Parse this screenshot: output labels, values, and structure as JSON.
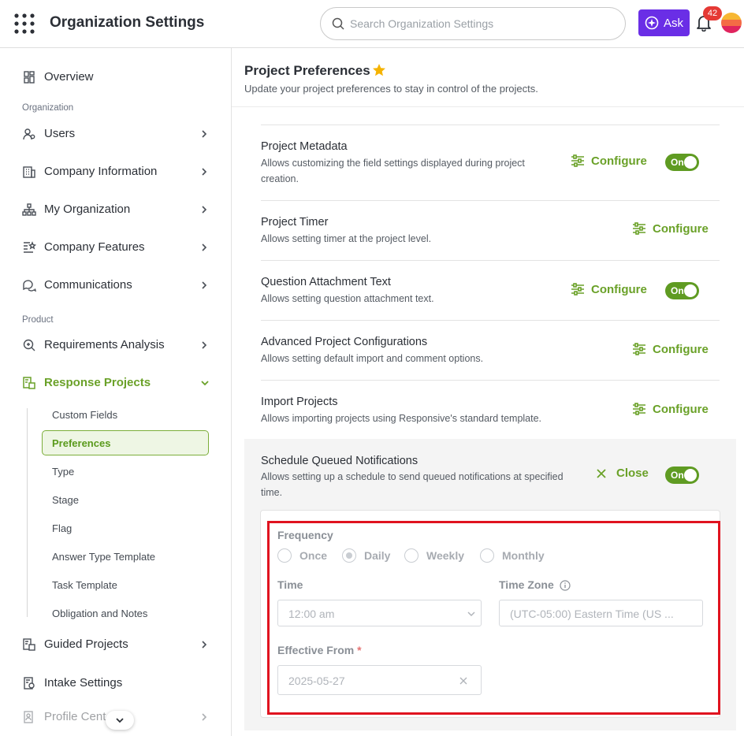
{
  "header": {
    "title": "Organization Settings",
    "search_placeholder": "Search Organization Settings",
    "ask_label": "Ask",
    "notification_count": "42"
  },
  "sidebar": {
    "items_top": [
      {
        "label": "Overview",
        "icon": "overview-icon"
      }
    ],
    "section_org": "Organization",
    "org_items": [
      {
        "label": "Users",
        "icon": "users-icon"
      },
      {
        "label": "Company Information",
        "icon": "building-icon"
      },
      {
        "label": "My Organization",
        "icon": "org-chart-icon"
      },
      {
        "label": "Company Features",
        "icon": "features-icon"
      },
      {
        "label": "Communications",
        "icon": "chat-icon"
      }
    ],
    "section_product": "Product",
    "product_items": [
      {
        "label": "Requirements Analysis",
        "icon": "analysis-icon"
      },
      {
        "label": "Response Projects",
        "icon": "response-projects-icon",
        "active": true
      },
      {
        "label": "Guided Projects",
        "icon": "guided-projects-icon"
      },
      {
        "label": "Intake Settings",
        "icon": "intake-icon"
      },
      {
        "label": "Profile Cent",
        "icon": "profile-icon"
      }
    ],
    "sub_items": [
      "Custom Fields",
      "Preferences",
      "Type",
      "Stage",
      "Flag",
      "Answer Type Template",
      "Task Template",
      "Obligation and Notes"
    ],
    "selected_sub": "Preferences"
  },
  "page": {
    "title": "Project Preferences",
    "subtitle": "Update your project preferences to stay in control of the projects."
  },
  "configure_label": "Configure",
  "close_label": "Close",
  "toggle_on_label": "On",
  "rows": [
    {
      "title": "Project Metadata",
      "desc": "Allows customizing the field settings displayed during project creation.",
      "toggle": true
    },
    {
      "title": "Project Timer",
      "desc": "Allows setting timer at the project level.",
      "toggle": false
    },
    {
      "title": "Question Attachment Text",
      "desc": "Allows setting question attachment text.",
      "toggle": true
    },
    {
      "title": "Advanced Project Configurations",
      "desc": "Allows setting default import and comment options.",
      "toggle": false
    },
    {
      "title": "Import Projects",
      "desc": "Allows importing projects using Responsive's standard template.",
      "toggle": false
    }
  ],
  "schedule": {
    "title": "Schedule Queued Notifications",
    "desc": "Allows setting up a schedule to send queued notifications at specified time.",
    "frequency_label": "Frequency",
    "frequency_options": [
      "Once",
      "Daily",
      "Weekly",
      "Monthly"
    ],
    "frequency_selected": "Daily",
    "time_label": "Time",
    "time_value": "12:00 am",
    "timezone_label": "Time Zone",
    "timezone_value": "(UTC-05:00) Eastern Time (US ...",
    "effective_label": "Effective From",
    "effective_value": "2025-05-27"
  },
  "colors": {
    "accent_green": "#6aa128",
    "ask_purple": "#6a2ee6",
    "highlight_red": "#e0131f"
  }
}
